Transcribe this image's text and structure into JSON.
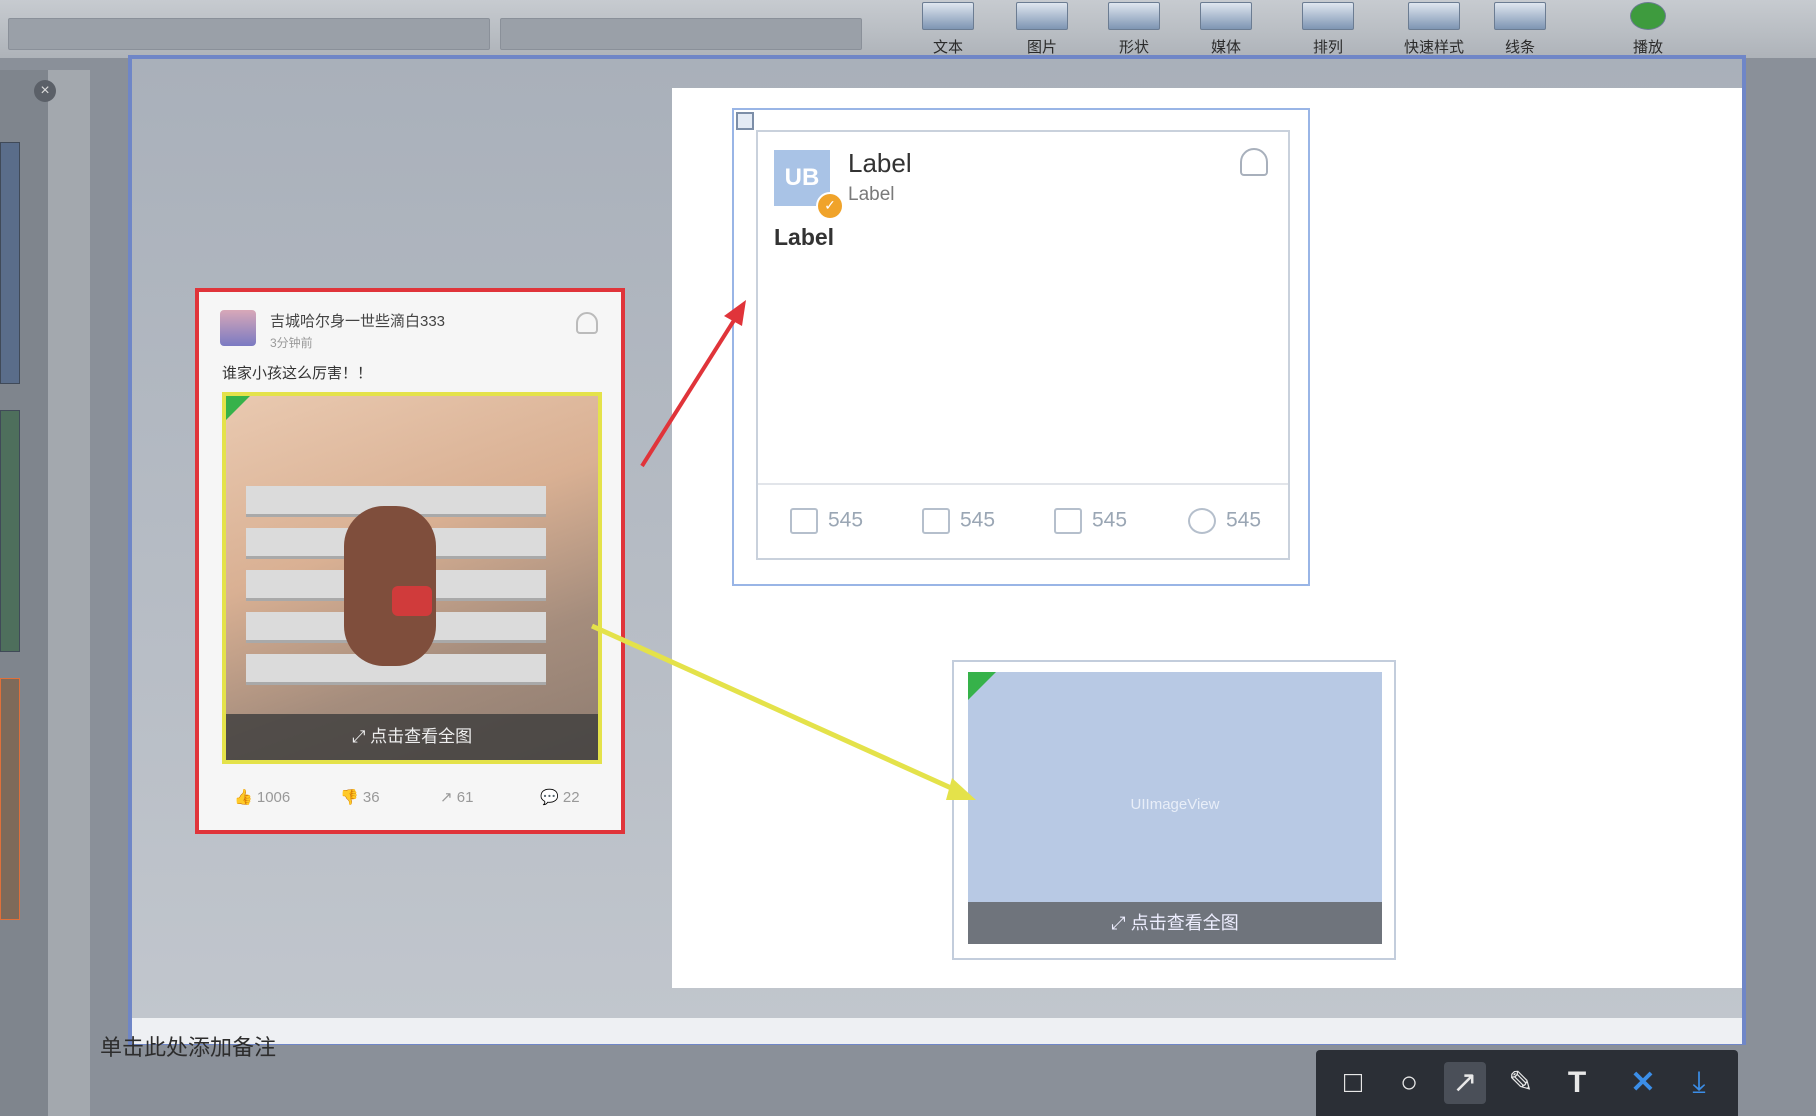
{
  "ribbon": {
    "items": [
      {
        "label": "文本",
        "icon": "text-box-icon"
      },
      {
        "label": "图片",
        "icon": "picture-icon"
      },
      {
        "label": "形状",
        "icon": "shape-icon"
      },
      {
        "label": "媒体",
        "icon": "media-icon"
      },
      {
        "label": "排列",
        "icon": "arrange-icon"
      },
      {
        "label": "快速样式",
        "icon": "quick-style-icon"
      },
      {
        "label": "线条",
        "icon": "line-icon"
      },
      {
        "label": "播放",
        "icon": "play-icon"
      }
    ]
  },
  "notes": {
    "placeholder": "单击此处添加备注"
  },
  "weibo_card": {
    "username": "吉城哈尔身一世些滴白333",
    "time": "3分钟前",
    "text": "谁家小孩这么厉害！！",
    "photo_caption": "点击查看全图",
    "likes": "1006",
    "dislikes": "36",
    "shares": "61",
    "comments": "22"
  },
  "label_card": {
    "avatar_text": "UB",
    "title": "Label",
    "subtitle": "Label",
    "body": "Label",
    "likes": "545",
    "dislikes": "545",
    "shares": "545",
    "comments": "545"
  },
  "image_card": {
    "placeholder": "UIImageView",
    "caption": "点击查看全图"
  },
  "toolbar": {
    "tools": [
      "rectangle-icon",
      "circle-icon",
      "arrow-icon",
      "brush-icon",
      "text-icon",
      "close-icon",
      "download-icon"
    ]
  },
  "colors": {
    "red_highlight": "#e0343a",
    "yellow_highlight": "#e4e24a",
    "selection_blue": "#6f86c7"
  }
}
